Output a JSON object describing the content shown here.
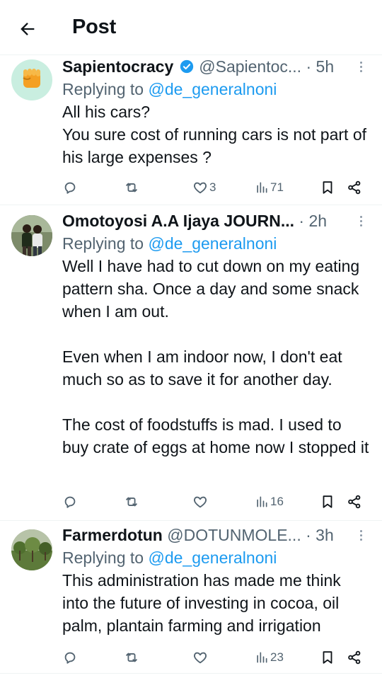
{
  "header": {
    "title": "Post"
  },
  "colors": {
    "accent": "#1d9bf0",
    "secondary": "#536471",
    "text": "#0f1419"
  },
  "tweets": [
    {
      "author": "Sapientocracy",
      "verified": true,
      "handle": "@Sapientoc...",
      "time": "5h",
      "reply_prefix": "Replying to ",
      "reply_to": "@de_generalnoni",
      "text": "All his cars?\nYou sure cost of running cars is not part of his large expenses ?",
      "likes": "3",
      "views": "71"
    },
    {
      "author": "Omotoyosi A.A Ijaya JOURN...",
      "verified": false,
      "handle": "",
      "time": "2h",
      "reply_prefix": "Replying to ",
      "reply_to": "@de_generalnoni",
      "text": "Well I have had to cut down on my eating pattern sha. Once a day and some snack when I am out.\n\nEven when I am indoor now, I don't eat much so as to save it for another day.\n\nThe cost of foodstuffs is mad. I used to buy crate of eggs at home now I stopped it",
      "likes": "",
      "views": "16"
    },
    {
      "author": "Farmerdotun",
      "verified": false,
      "handle": "@DOTUNMOLE...",
      "time": "3h",
      "reply_prefix": "Replying to ",
      "reply_to": "@de_generalnoni",
      "text": "This administration has made me think into the future of investing in cocoa, oil palm, plantain farming and irrigation",
      "likes": "",
      "views": "23"
    }
  ]
}
